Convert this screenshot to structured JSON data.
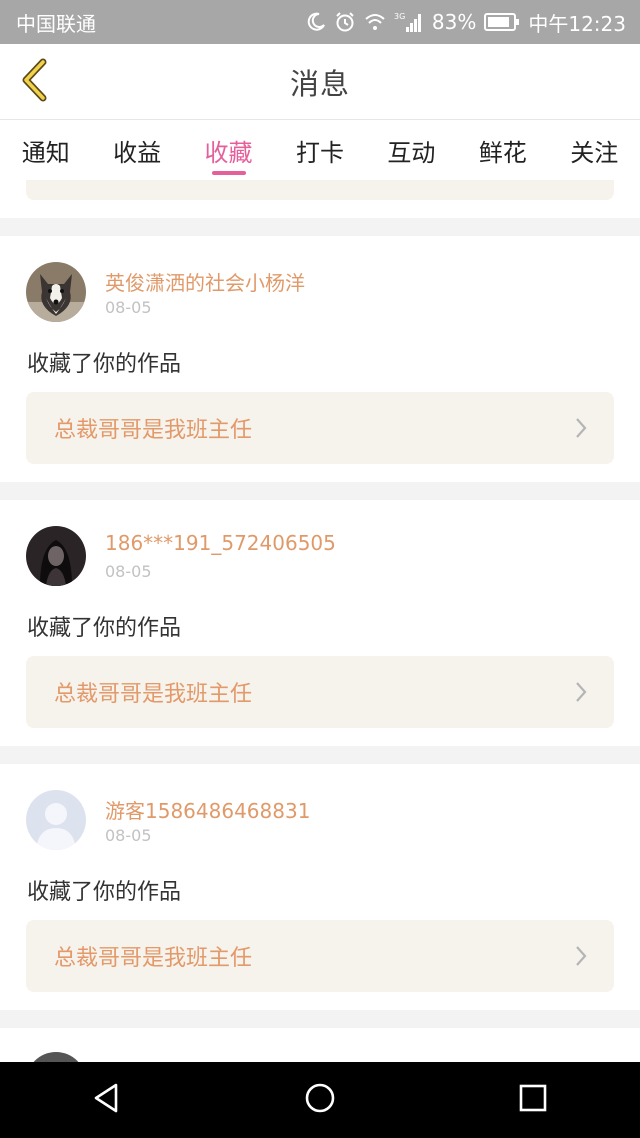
{
  "status_bar": {
    "carrier": "中国联通",
    "network": "3G",
    "battery": "83%",
    "time": "中午12:23"
  },
  "header": {
    "title": "消息",
    "back_icon": "chevron-left-icon"
  },
  "tabs": [
    {
      "label": "通知",
      "active": false
    },
    {
      "label": "收益",
      "active": false
    },
    {
      "label": "收藏",
      "active": true
    },
    {
      "label": "打卡",
      "active": false
    },
    {
      "label": "互动",
      "active": false
    },
    {
      "label": "鲜花",
      "active": false
    },
    {
      "label": "关注",
      "active": false
    }
  ],
  "messages": [
    {
      "username": "英俊潇洒的社会小杨洋",
      "date": "08-05",
      "action": "收藏了你的作品",
      "work_title": "总裁哥哥是我班主任",
      "avatar": "husky-avatar"
    },
    {
      "username": "186***191_572406505",
      "date": "08-05",
      "action": "收藏了你的作品",
      "work_title": "总裁哥哥是我班主任",
      "avatar": "dark-portrait-avatar"
    },
    {
      "username": "游客1586486468831",
      "date": "08-05",
      "action": "收藏了你的作品",
      "work_title": "总裁哥哥是我班主任",
      "avatar": "default-user-avatar"
    }
  ],
  "colors": {
    "accent": "#e5609b",
    "username": "#e09a6a",
    "work_title": "#e3996a",
    "card_bg": "#f5f3ec",
    "status_bar": "#a7a7a7"
  },
  "system_nav": {
    "back_icon": "triangle-back-icon",
    "home_icon": "circle-home-icon",
    "recents_icon": "square-recents-icon"
  }
}
